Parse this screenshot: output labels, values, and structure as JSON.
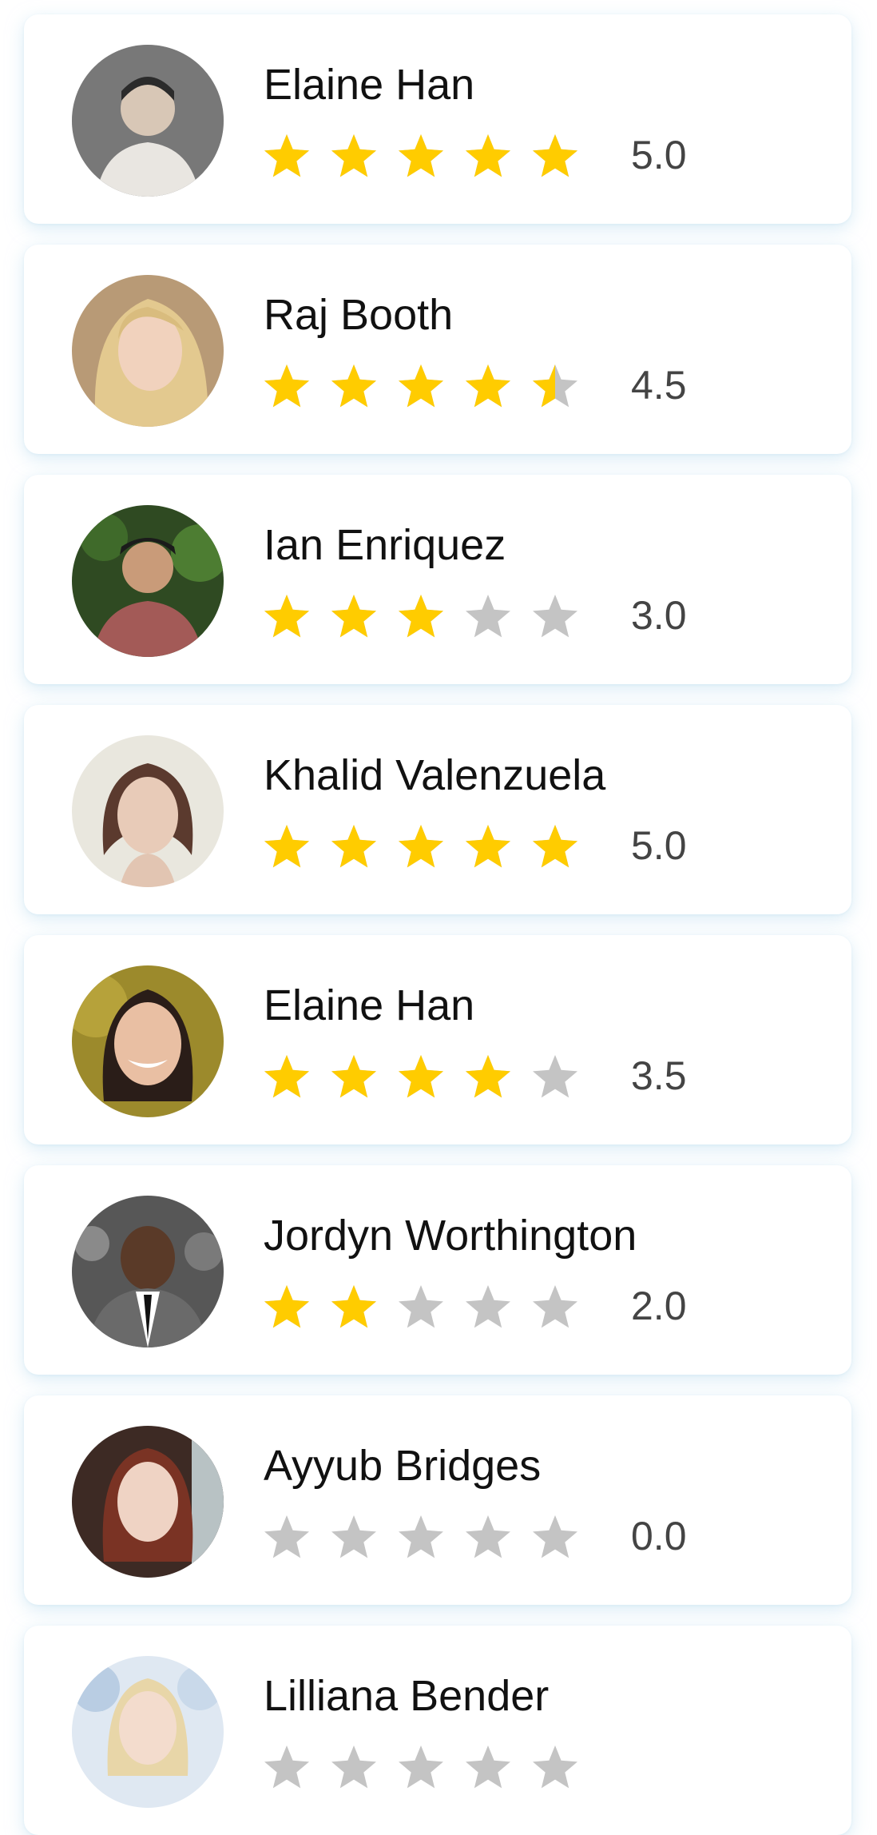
{
  "colors": {
    "star_filled": "#FFCC00",
    "star_empty": "#C4C4C4",
    "name_text": "#111111",
    "score_text": "#444444"
  },
  "people": [
    {
      "name": "Elaine Han",
      "rating": 5.0,
      "score_label": "5.0",
      "avatar_icon": "avatar-photo"
    },
    {
      "name": "Raj Booth",
      "rating": 4.5,
      "score_label": "4.5",
      "avatar_icon": "avatar-photo"
    },
    {
      "name": "Ian Enriquez",
      "rating": 3.0,
      "score_label": "3.0",
      "avatar_icon": "avatar-photo"
    },
    {
      "name": "Khalid Valenzuela",
      "rating": 5.0,
      "score_label": "5.0",
      "avatar_icon": "avatar-photo"
    },
    {
      "name": "Elaine Han",
      "rating": 4.0,
      "score_label": "3.5",
      "avatar_icon": "avatar-photo"
    },
    {
      "name": "Jordyn Worthington",
      "rating": 2.0,
      "score_label": "2.0",
      "avatar_icon": "avatar-photo"
    },
    {
      "name": "Ayyub Bridges",
      "rating": 0.0,
      "score_label": "0.0",
      "avatar_icon": "avatar-photo"
    },
    {
      "name": "Lilliana Bender",
      "rating": 0.0,
      "score_label": "",
      "avatar_icon": "avatar-photo"
    }
  ]
}
